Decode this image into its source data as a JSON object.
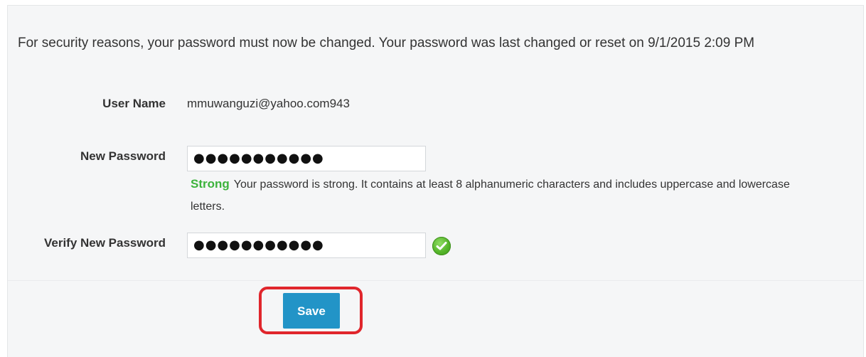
{
  "notice": {
    "text": "For security reasons, your password must now be changed. Your password was last changed or reset on 9/1/2015 2:09 PM"
  },
  "form": {
    "username_label": "User Name",
    "username_value": "mmuwanguzi@yahoo.com943",
    "new_password_label": "New Password",
    "new_password_value": "●●●●●●●●●●●",
    "strength_word": "Strong",
    "strength_message": "Your password is strong. It contains at least 8 alphanumeric characters and includes uppercase and lowercase letters.",
    "verify_password_label": "Verify New Password",
    "verify_password_value": "●●●●●●●●●●●",
    "verify_status_icon": "check-circle-icon"
  },
  "actions": {
    "save_label": "Save"
  },
  "colors": {
    "strength_green": "#3cb33c",
    "button_blue": "#2294c7",
    "highlight_red": "#e0262c"
  }
}
